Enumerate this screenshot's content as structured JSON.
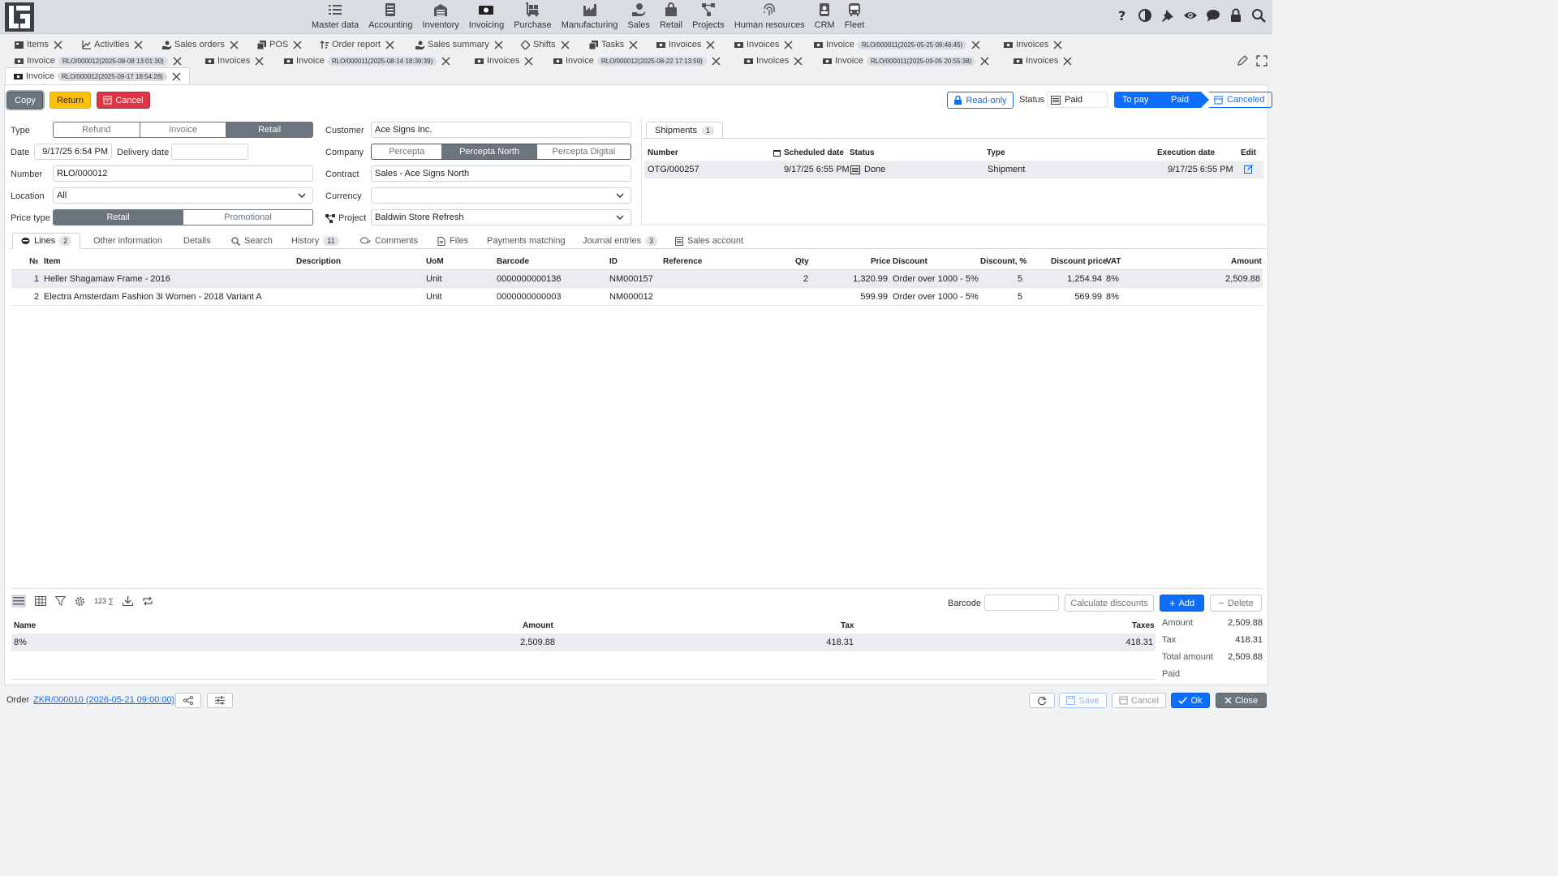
{
  "modules": [
    {
      "label": "Master data",
      "icon": "list-icon"
    },
    {
      "label": "Accounting",
      "icon": "ledger-icon"
    },
    {
      "label": "Inventory",
      "icon": "warehouse-icon"
    },
    {
      "label": "Invoicing",
      "icon": "cash-icon"
    },
    {
      "label": "Purchase",
      "icon": "dolly-icon"
    },
    {
      "label": "Manufacturing",
      "icon": "factory-icon"
    },
    {
      "label": "Sales",
      "icon": "hand-money-icon"
    },
    {
      "label": "Retail",
      "icon": "bag-icon"
    },
    {
      "label": "Projects",
      "icon": "diagram-icon"
    },
    {
      "label": "Human resources",
      "icon": "fingerprint-icon"
    },
    {
      "label": "CRM",
      "icon": "id-badge-icon"
    },
    {
      "label": "Fleet",
      "icon": "bus-icon"
    }
  ],
  "tabs": {
    "row1": [
      {
        "label": "Items"
      },
      {
        "label": "Activities"
      },
      {
        "label": "Sales orders"
      },
      {
        "label": "POS"
      },
      {
        "label": "Order report"
      },
      {
        "label": "Sales summary"
      },
      {
        "label": "Shifts"
      },
      {
        "label": "Tasks"
      },
      {
        "label": "Invoices"
      },
      {
        "label": "Invoices"
      },
      {
        "label": "Invoice",
        "sub": "RLO/000011(2025-05-25 09:46:45)"
      },
      {
        "label": "Invoices"
      }
    ],
    "row2": [
      {
        "label": "Invoice",
        "sub": "RLO/000012(2025-08-08 13:01:30)"
      },
      {
        "label": "Invoices"
      },
      {
        "label": "Invoice",
        "sub": "RLO/000011(2025-08-14 18:39:39)"
      },
      {
        "label": "Invoices"
      },
      {
        "label": "Invoice",
        "sub": "RLO/000012(2025-08-22 17:13:59)"
      },
      {
        "label": "Invoices"
      },
      {
        "label": "Invoice",
        "sub": "RLO/000011(2025-09-05 20:55:38)"
      },
      {
        "label": "Invoices"
      }
    ],
    "active": {
      "label": "Invoice",
      "sub": "RLO/000012(2025-09-17 18:54:28)"
    }
  },
  "actions": {
    "copy": "Copy",
    "return": "Return",
    "cancel": "Cancel",
    "readonly": "Read-only",
    "status_label": "Status",
    "status_value": "Paid"
  },
  "pipeline": [
    "To pay",
    "Paid",
    "Canceled"
  ],
  "form": {
    "type_label": "Type",
    "type_options": [
      "Refund",
      "Invoice",
      "Retail"
    ],
    "date_label": "Date",
    "date": "9/17/25 6:54 PM",
    "delivery_label": "Delivery date",
    "delivery": "",
    "number_label": "Number",
    "number": "RLO/000012",
    "location_label": "Location",
    "location": "All",
    "price_type_label": "Price type",
    "price_type_options": [
      "Retail",
      "Promotional"
    ],
    "customer_label": "Customer",
    "customer": "Ace Signs Inc.",
    "company_label": "Company",
    "company_options": [
      "Percepta",
      "Percepta North",
      "Percepta Digital"
    ],
    "contract_label": "Contract",
    "contract": "Sales - Ace Signs North",
    "currency_label": "Currency",
    "currency": "",
    "project_label": "Project",
    "project": "Baldwin Store Refresh"
  },
  "shipments": {
    "tab": "Shipments",
    "count": "1",
    "headers": [
      "Number",
      "Scheduled date",
      "Status",
      "Type",
      "Execution date",
      "Edit"
    ],
    "rows": [
      {
        "number": "OTG/000257",
        "scheduled": "9/17/25 6:55 PM",
        "status": "Done",
        "type": "Shipment",
        "executed": "9/17/25 6:55 PM"
      }
    ]
  },
  "doctabs": [
    {
      "label": "Lines",
      "badge": "2"
    },
    {
      "label": "Other information"
    },
    {
      "label": "Details"
    },
    {
      "label": "Search"
    },
    {
      "label": "History",
      "badge": "11"
    },
    {
      "label": "Comments"
    },
    {
      "label": "Files"
    },
    {
      "label": "Payments matching"
    },
    {
      "label": "Journal entries",
      "badge": "3"
    },
    {
      "label": "Sales account"
    }
  ],
  "lines": {
    "headers": {
      "no": "№",
      "item": "Item",
      "desc": "Description",
      "uom": "UoM",
      "barcode": "Barcode",
      "id": "ID",
      "ref": "Reference",
      "qty": "Qty",
      "price": "Price",
      "discount": "Discount",
      "disc_pct": "Discount, %",
      "disc_price": "Discount price",
      "vat": "VAT",
      "amount": "Amount"
    },
    "rows": [
      {
        "no": "1",
        "item": "Heller Shagamaw Frame - 2016",
        "uom": "Unit",
        "barcode": "0000000000136",
        "id": "NM000157",
        "qty": "2",
        "price": "1,320.99",
        "discount": "Order over 1000 - 5%",
        "disc_pct": "5",
        "disc_price": "1,254.94",
        "vat": "8%",
        "amount": "2,509.88"
      },
      {
        "no": "2",
        "item": "Electra Amsterdam Fashion 3i Women - 2018 Variant A",
        "uom": "Unit",
        "barcode": "0000000000003",
        "id": "NM000012",
        "qty": "",
        "price": "599.99",
        "discount": "Order over 1000 - 5%",
        "disc_pct": "5",
        "disc_price": "569.99",
        "vat": "8%",
        "amount": ""
      }
    ]
  },
  "toolbar": {
    "sum": "123 ∑",
    "barcode_label": "Barcode",
    "calc": "Calculate discounts",
    "add": "Add",
    "delete": "Delete"
  },
  "taxes": {
    "headers": {
      "name": "Name",
      "amount": "Amount",
      "tax": "Tax",
      "taxes": "Taxes"
    },
    "row": {
      "name": "8%",
      "amount": "2,509.88",
      "tax": "418.31",
      "taxes": "418.31"
    }
  },
  "totals": [
    {
      "label": "Amount",
      "value": "2,509.88"
    },
    {
      "label": "Tax",
      "value": "418.31"
    },
    {
      "label": "Total amount",
      "value": "2,509.88"
    },
    {
      "label": "Paid",
      "value": ""
    }
  ],
  "bottom": {
    "order_label": "Order",
    "order_link": "ZKR/000010 (2026-05-21 09:00:00)",
    "save": "Save",
    "cancel": "Cancel",
    "ok": "Ok",
    "close": "Close"
  }
}
